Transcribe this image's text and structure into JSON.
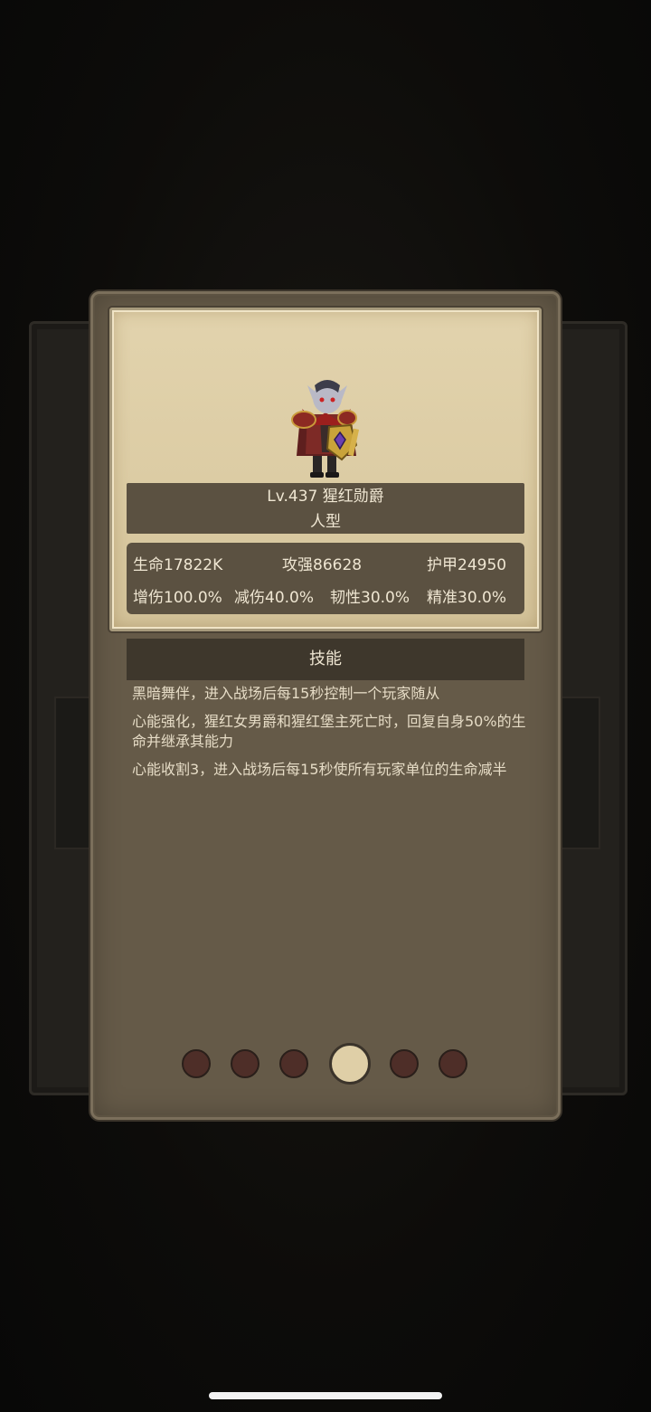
{
  "unit": {
    "name_line": "Lv.437 猩红勋爵",
    "type": "人型"
  },
  "stats": {
    "hp": "生命17822K",
    "attack": "攻强86628",
    "armor": "护甲24950",
    "dmg_boost": "增伤100.0%",
    "dmg_reduce": "减伤40.0%",
    "toughness": "韧性30.0%",
    "precision": "精准30.0%"
  },
  "skills": {
    "header": "技能",
    "items": [
      "黑暗舞伴，进入战场后每15秒控制一个玩家随从",
      "心能强化，猩红女男爵和猩红堡主死亡时，回复自身50%的生命并继承其能力",
      "心能收割3，进入战场后每15秒使所有玩家单位的生命减半"
    ]
  },
  "pager": {
    "count": 6,
    "active_index": 3
  },
  "colors": {
    "card": "#655a48",
    "parchment": "#e2d3ad",
    "banner": "#5b5141",
    "dot": "#4e2e28",
    "dot_active": "#dfcfa7"
  }
}
